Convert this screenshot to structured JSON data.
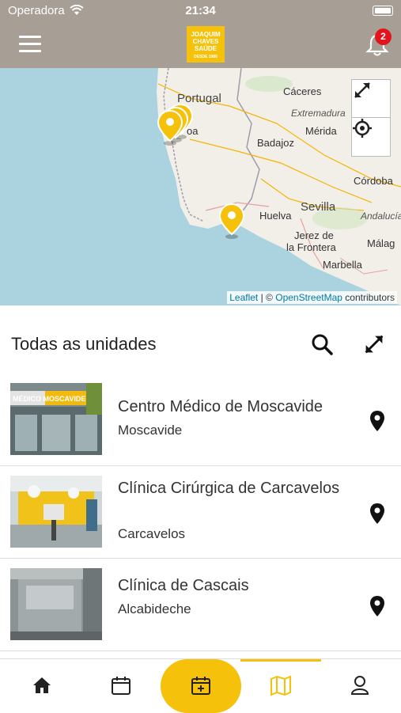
{
  "status_bar": {
    "carrier": "Operadora",
    "time": "21:34"
  },
  "header": {
    "logo_lines": [
      "JOAQUIM",
      "CHAVES",
      "SAÚDE"
    ],
    "logo_tagline": "DESDE 1986",
    "notification_count": "2"
  },
  "map": {
    "labels": {
      "portugal": "Portugal",
      "caceres": "Cáceres",
      "extremadura": "Extremadura",
      "merida": "Mérida",
      "badajoz": "Badajoz",
      "cordoba": "Córdoba",
      "sevilla": "Sevilla",
      "huelva": "Huelva",
      "andalucia": "Andalucía",
      "jerez_1": "Jerez de",
      "jerez_2": "la Frontera",
      "malaga": "Málag",
      "marbella": "Marbella",
      "lisboa": "oa"
    },
    "attribution_leaflet": "Leaflet",
    "attribution_sep": "| ©",
    "attribution_osm": "OpenStreetMap",
    "attribution_tail": "contributors"
  },
  "section": {
    "title": "Todas as unidades"
  },
  "units": [
    {
      "name": "Centro Médico de Moscavide",
      "city": "Moscavide",
      "thumb_sign": "MÉDICO MOSCAVIDE"
    },
    {
      "name": "Clínica Cirúrgica de Carcavelos",
      "city": "Carcavelos"
    },
    {
      "name": "Clínica de Cascais",
      "city": "Alcabideche"
    }
  ],
  "icons": {
    "menu": "hamburger-menu-icon",
    "bell": "bell-icon",
    "fullscreen": "expand-icon",
    "locate": "crosshair-icon",
    "search": "search-icon",
    "pin": "map-pin-icon",
    "home": "home-icon",
    "calendar": "calendar-icon",
    "calendar_add": "calendar-add-icon",
    "map": "map-icon",
    "profile": "user-icon"
  },
  "colors": {
    "accent": "#f5c10a",
    "header": "#a79f95",
    "badge": "#e3141b"
  },
  "tabs": {
    "active": "map"
  }
}
